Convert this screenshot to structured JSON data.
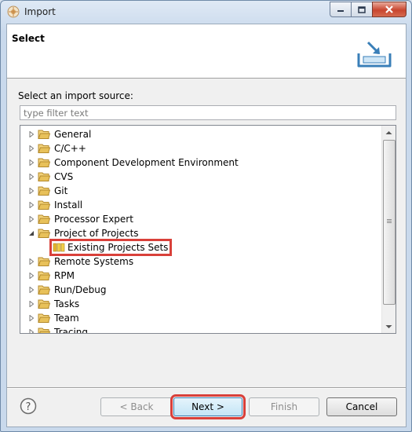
{
  "window": {
    "title": "Import"
  },
  "header": {
    "title": "Select"
  },
  "source": {
    "label": "Select an import source:",
    "filter_placeholder": "type filter text"
  },
  "tree": {
    "items": [
      {
        "label": "General",
        "expanded": false
      },
      {
        "label": "C/C++",
        "expanded": false
      },
      {
        "label": "Component Development Environment",
        "expanded": false
      },
      {
        "label": "CVS",
        "expanded": false
      },
      {
        "label": "Git",
        "expanded": false
      },
      {
        "label": "Install",
        "expanded": false
      },
      {
        "label": "Processor Expert",
        "expanded": false
      },
      {
        "label": "Project of Projects",
        "expanded": true
      },
      {
        "label": "Existing Projects Sets",
        "child": true,
        "selected": true
      },
      {
        "label": "Remote Systems",
        "expanded": false
      },
      {
        "label": "RPM",
        "expanded": false
      },
      {
        "label": "Run/Debug",
        "expanded": false
      },
      {
        "label": "Tasks",
        "expanded": false
      },
      {
        "label": "Team",
        "expanded": false
      },
      {
        "label": "Tracing",
        "expanded": false
      }
    ]
  },
  "buttons": {
    "back": "< Back",
    "next": "Next >",
    "finish": "Finish",
    "cancel": "Cancel"
  },
  "colors": {
    "highlight": "#d9403a",
    "folder": "#e8c15a",
    "close_button": "#c8452f"
  }
}
